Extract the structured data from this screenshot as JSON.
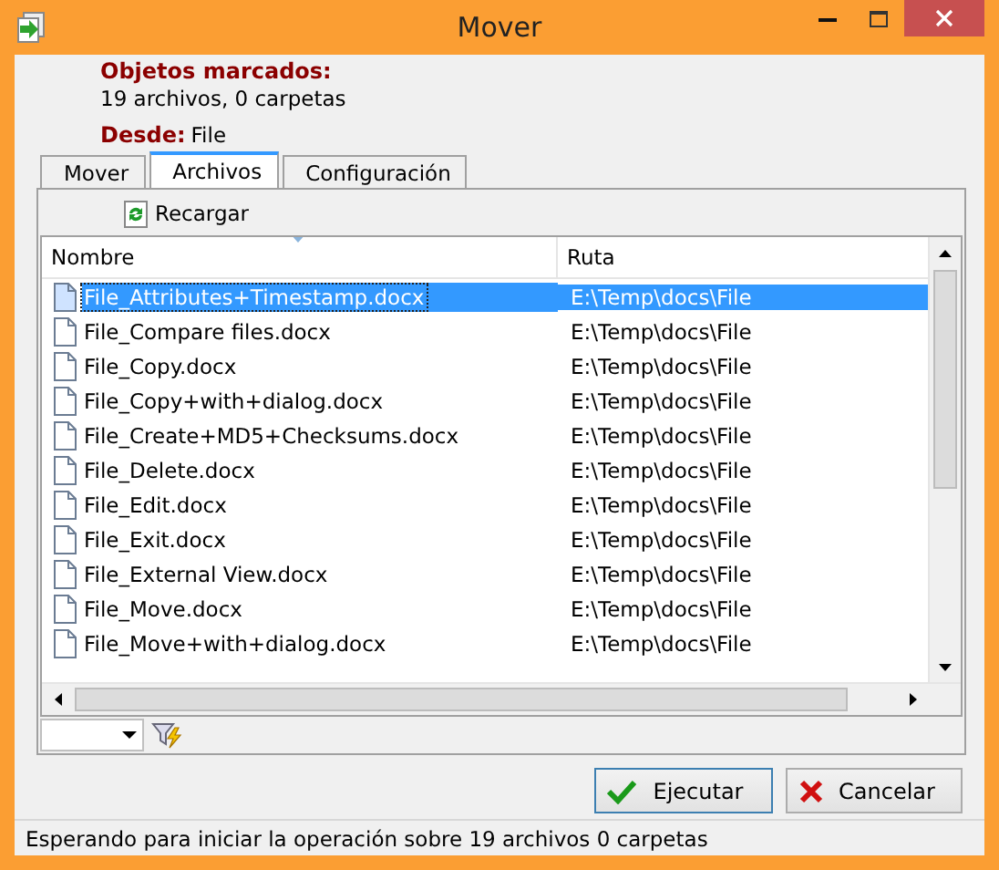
{
  "window": {
    "title": "Mover"
  },
  "summary": {
    "label": "Objetos marcados:",
    "value": "19 archivos, 0 carpetas"
  },
  "source": {
    "label": "Desde:",
    "value": "File"
  },
  "tabs": [
    {
      "label": "Mover",
      "selected": false
    },
    {
      "label": "Archivos",
      "selected": true
    },
    {
      "label": "Configuración",
      "selected": false
    }
  ],
  "toolbar": {
    "reload": "Recargar"
  },
  "table": {
    "columns": [
      "Nombre",
      "Ruta"
    ],
    "rows": [
      {
        "name": "File_Attributes+Timestamp.docx",
        "path": "E:\\Temp\\docs\\File",
        "selected": true
      },
      {
        "name": "File_Compare files.docx",
        "path": "E:\\Temp\\docs\\File",
        "selected": false
      },
      {
        "name": "File_Copy.docx",
        "path": "E:\\Temp\\docs\\File",
        "selected": false
      },
      {
        "name": "File_Copy+with+dialog.docx",
        "path": "E:\\Temp\\docs\\File",
        "selected": false
      },
      {
        "name": "File_Create+MD5+Checksums.docx",
        "path": "E:\\Temp\\docs\\File",
        "selected": false
      },
      {
        "name": "File_Delete.docx",
        "path": "E:\\Temp\\docs\\File",
        "selected": false
      },
      {
        "name": "File_Edit.docx",
        "path": "E:\\Temp\\docs\\File",
        "selected": false
      },
      {
        "name": "File_Exit.docx",
        "path": "E:\\Temp\\docs\\File",
        "selected": false
      },
      {
        "name": "File_External View.docx",
        "path": "E:\\Temp\\docs\\File",
        "selected": false
      },
      {
        "name": "File_Move.docx",
        "path": "E:\\Temp\\docs\\File",
        "selected": false
      },
      {
        "name": "File_Move+with+dialog.docx",
        "path": "E:\\Temp\\docs\\File",
        "selected": false
      }
    ]
  },
  "buttons": [
    {
      "label": "Ejecutar",
      "kind": "ok"
    },
    {
      "label": "Cancelar",
      "kind": "cancel"
    }
  ],
  "status_bar": "Esperando para iniciar la operación sobre 19 archivos 0 carpetas"
}
